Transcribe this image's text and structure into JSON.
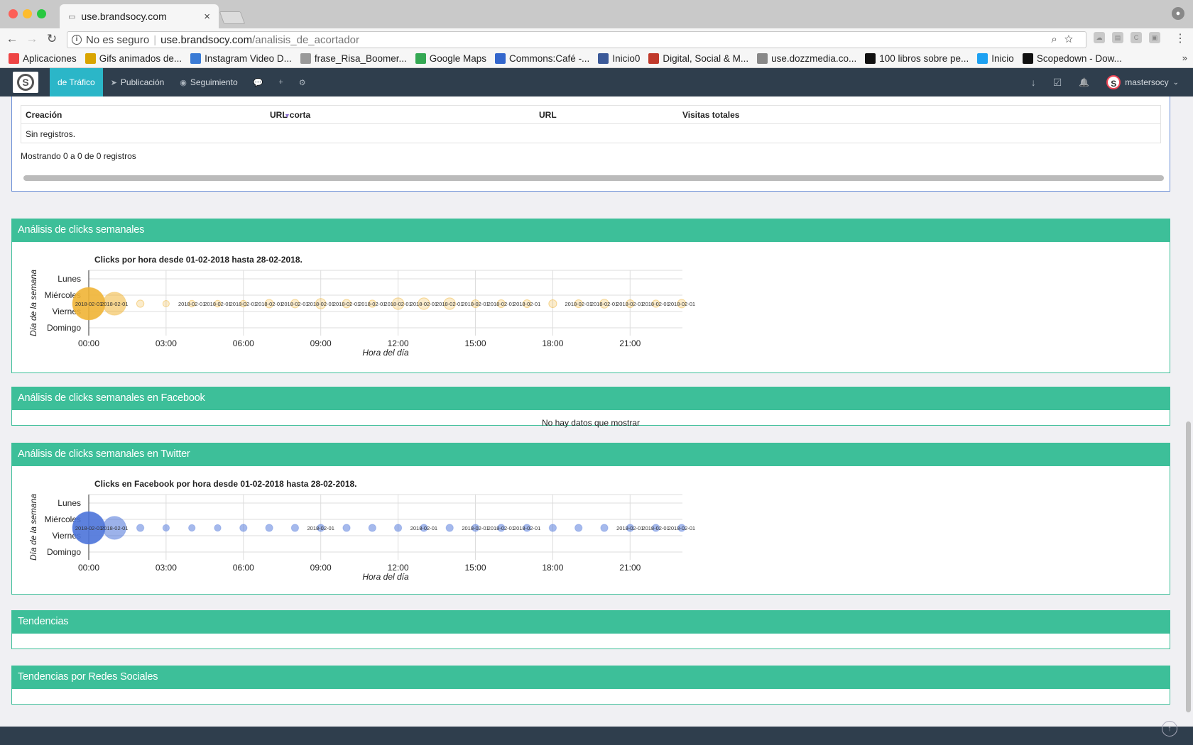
{
  "browser": {
    "tab_title": "use.brandsocy.com",
    "tab_close": "×",
    "not_secure": "No es seguro",
    "url_host": "use.brandsocy.com",
    "url_path": "/analisis_de_acortador",
    "bookmarks": [
      {
        "label": "Aplicaciones",
        "color": "#e44"
      },
      {
        "label": "Gifs animados de...",
        "color": "#d9a400"
      },
      {
        "label": "Instagram Video D...",
        "color": "#3a7bd5"
      },
      {
        "label": "frase_Risa_Boomer...",
        "color": "#999"
      },
      {
        "label": "Google Maps",
        "color": "#34a853"
      },
      {
        "label": "Commons:Café -...",
        "color": "#3366cc"
      },
      {
        "label": "Inicio0",
        "color": "#3b5998"
      },
      {
        "label": "Digital, Social & M...",
        "color": "#c0392b"
      },
      {
        "label": "use.dozzmedia.co...",
        "color": "#888"
      },
      {
        "label": "100 libros sobre pe...",
        "color": "#111"
      },
      {
        "label": "Inicio",
        "color": "#1da1f2"
      },
      {
        "label": "Scopedown - Dow...",
        "color": "#111"
      }
    ],
    "bookmarks_more": "»"
  },
  "appnav": {
    "logo": "S",
    "items": [
      {
        "label": "de Tráfico",
        "icon": "",
        "active": true
      },
      {
        "label": "Publicación",
        "icon": "➤",
        "active": false
      },
      {
        "label": "Seguimiento",
        "icon": "◉",
        "active": false
      },
      {
        "label": "",
        "icon": "💬",
        "active": false
      },
      {
        "label": "",
        "icon": "+",
        "active": false
      },
      {
        "label": "",
        "icon": "⚙",
        "active": false
      }
    ],
    "right_icons": [
      "↓",
      "☑",
      "🔔"
    ],
    "user": {
      "avatar": "S",
      "name": "mastersocy",
      "caret": "⌄"
    }
  },
  "table": {
    "columns": [
      "Creación",
      "URL corta",
      "URL",
      "Visitas totales"
    ],
    "sort_indicator": "▼",
    "empty": "Sin registros.",
    "showing": "Mostrando 0 a 0 de 0 registros"
  },
  "panels": {
    "weekly": "Análisis de clicks semanales",
    "facebook": "Análisis de clicks semanales en Facebook",
    "facebook_nodata": "No hay datos que mostrar",
    "twitter": "Análisis de clicks semanales en Twitter",
    "trends": "Tendencias",
    "trends_social": "Tendencias por Redes Sociales"
  },
  "chart_data": [
    {
      "type": "scatter",
      "title": "Clicks por hora desde 01-02-2018 hasta 28-02-2018.",
      "xlabel": "Hora del día",
      "ylabel": "Día de la semana",
      "xlim": [
        0,
        23
      ],
      "x_ticks": [
        "00:00",
        "03:00",
        "06:00",
        "09:00",
        "12:00",
        "15:00",
        "18:00",
        "21:00"
      ],
      "x_tick_values": [
        0,
        3,
        6,
        9,
        12,
        15,
        18,
        21
      ],
      "y_ticks": [
        "Lunes",
        "Miércoles",
        "Viernes",
        "Domingo"
      ],
      "color": "#f0b435",
      "point_label": "2018-02-01",
      "points": [
        {
          "hour": 0,
          "value": 12,
          "label": true
        },
        {
          "hour": 1,
          "value": 6,
          "label": true
        },
        {
          "hour": 2,
          "value": 0.6,
          "label": false
        },
        {
          "hour": 3,
          "value": 0.4,
          "label": false
        },
        {
          "hour": 4,
          "value": 0.5,
          "label": true
        },
        {
          "hour": 5,
          "value": 0.5,
          "label": true
        },
        {
          "hour": 6,
          "value": 0.5,
          "label": true
        },
        {
          "hour": 7,
          "value": 0.8,
          "label": true
        },
        {
          "hour": 8,
          "value": 0.8,
          "label": true
        },
        {
          "hour": 9,
          "value": 1.2,
          "label": true
        },
        {
          "hour": 10,
          "value": 0.8,
          "label": true
        },
        {
          "hour": 11,
          "value": 0.6,
          "label": true
        },
        {
          "hour": 12,
          "value": 1.5,
          "label": true
        },
        {
          "hour": 13,
          "value": 1.5,
          "label": true
        },
        {
          "hour": 14,
          "value": 1.5,
          "label": true
        },
        {
          "hour": 15,
          "value": 0.7,
          "label": true
        },
        {
          "hour": 16,
          "value": 0.7,
          "label": true
        },
        {
          "hour": 17,
          "value": 0.7,
          "label": true
        },
        {
          "hour": 18,
          "value": 0.7,
          "label": false
        },
        {
          "hour": 19,
          "value": 0.7,
          "label": true
        },
        {
          "hour": 20,
          "value": 0.9,
          "label": true
        },
        {
          "hour": 21,
          "value": 0.7,
          "label": true
        },
        {
          "hour": 22,
          "value": 0.6,
          "label": true
        },
        {
          "hour": 23,
          "value": 0.8,
          "label": true
        }
      ]
    },
    {
      "type": "scatter",
      "title": "Clicks en Facebook por hora desde 01-02-2018 hasta 28-02-2018.",
      "xlabel": "Hora del día",
      "ylabel": "Día de la semana",
      "xlim": [
        0,
        23
      ],
      "x_ticks": [
        "00:00",
        "03:00",
        "06:00",
        "09:00",
        "12:00",
        "15:00",
        "18:00",
        "21:00"
      ],
      "x_tick_values": [
        0,
        3,
        6,
        9,
        12,
        15,
        18,
        21
      ],
      "y_ticks": [
        "Lunes",
        "Miércoles",
        "Viernes",
        "Domingo"
      ],
      "color": "#4b73d9",
      "point_label": "2018-02-01",
      "points": [
        {
          "hour": 0,
          "value": 12,
          "label": true
        },
        {
          "hour": 1,
          "value": 6,
          "label": true
        },
        {
          "hour": 2,
          "value": 0.6,
          "label": false
        },
        {
          "hour": 3,
          "value": 0.5,
          "label": false
        },
        {
          "hour": 4,
          "value": 0.5,
          "label": false
        },
        {
          "hour": 5,
          "value": 0.5,
          "label": false
        },
        {
          "hour": 6,
          "value": 0.6,
          "label": false
        },
        {
          "hour": 7,
          "value": 0.6,
          "label": false
        },
        {
          "hour": 8,
          "value": 0.6,
          "label": false
        },
        {
          "hour": 9,
          "value": 0.6,
          "label": true
        },
        {
          "hour": 10,
          "value": 0.6,
          "label": false
        },
        {
          "hour": 11,
          "value": 0.6,
          "label": false
        },
        {
          "hour": 12,
          "value": 0.6,
          "label": false
        },
        {
          "hour": 13,
          "value": 0.6,
          "label": true
        },
        {
          "hour": 14,
          "value": 0.6,
          "label": false
        },
        {
          "hour": 15,
          "value": 0.6,
          "label": true
        },
        {
          "hour": 16,
          "value": 0.6,
          "label": true
        },
        {
          "hour": 17,
          "value": 0.6,
          "label": true
        },
        {
          "hour": 18,
          "value": 0.6,
          "label": false
        },
        {
          "hour": 19,
          "value": 0.6,
          "label": false
        },
        {
          "hour": 20,
          "value": 0.6,
          "label": false
        },
        {
          "hour": 21,
          "value": 0.6,
          "label": true
        },
        {
          "hour": 22,
          "value": 0.6,
          "label": true
        },
        {
          "hour": 23,
          "value": 0.6,
          "label": true
        }
      ]
    }
  ]
}
